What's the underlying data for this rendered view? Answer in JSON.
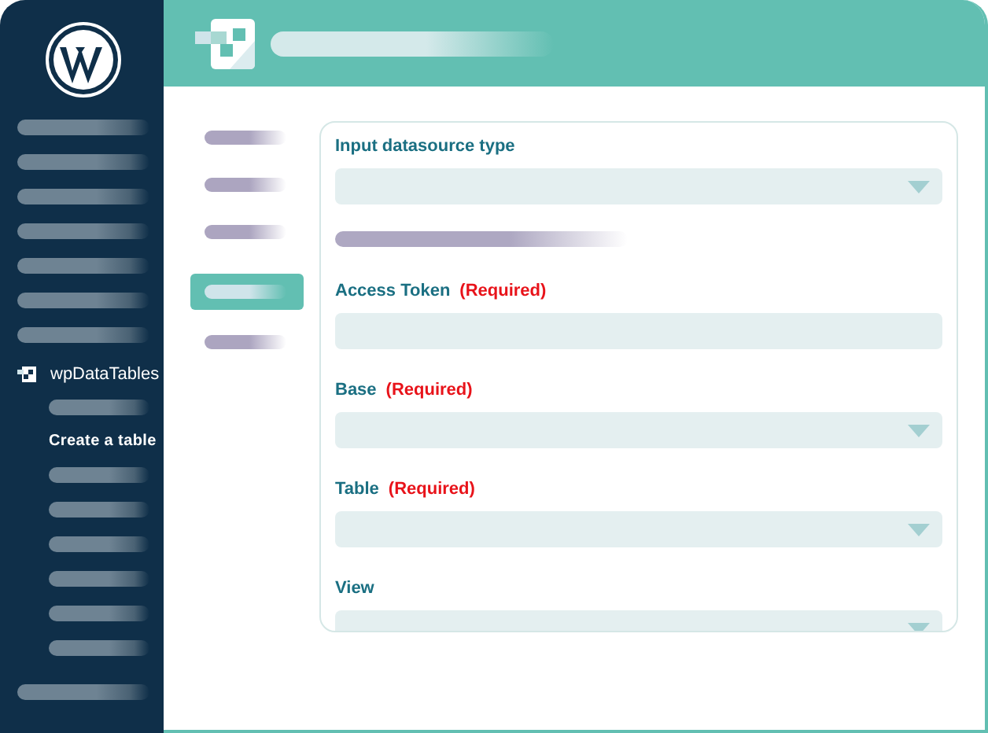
{
  "sidebar": {
    "items": [
      {
        "kind": "placeholder"
      },
      {
        "kind": "placeholder"
      },
      {
        "kind": "placeholder"
      },
      {
        "kind": "placeholder"
      },
      {
        "kind": "placeholder"
      },
      {
        "kind": "placeholder"
      },
      {
        "kind": "placeholder"
      },
      {
        "kind": "menu",
        "label": "wpDataTables",
        "children": [
          {
            "kind": "placeholder"
          },
          {
            "kind": "link",
            "label": "Create a table"
          },
          {
            "kind": "placeholder"
          },
          {
            "kind": "placeholder"
          },
          {
            "kind": "placeholder"
          },
          {
            "kind": "placeholder"
          },
          {
            "kind": "placeholder"
          },
          {
            "kind": "placeholder"
          }
        ]
      },
      {
        "kind": "placeholder"
      }
    ]
  },
  "tabs": [
    {
      "selected": false
    },
    {
      "selected": false
    },
    {
      "selected": false
    },
    {
      "selected": true
    },
    {
      "selected": false
    }
  ],
  "form": {
    "fields": [
      {
        "kind": "select",
        "label": "Input datasource type"
      },
      {
        "kind": "placeholder"
      },
      {
        "kind": "text",
        "label": "Access Token",
        "required": "(Required)"
      },
      {
        "kind": "select",
        "label": "Base",
        "required": "(Required)"
      },
      {
        "kind": "select",
        "label": "Table",
        "required": "(Required)"
      },
      {
        "kind": "select",
        "label": "View"
      }
    ]
  }
}
